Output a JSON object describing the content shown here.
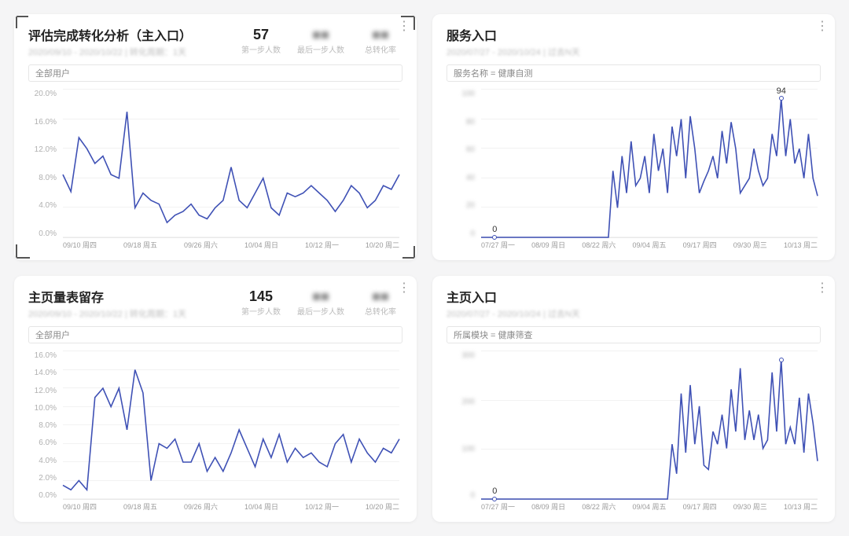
{
  "cards": [
    {
      "id": "card1",
      "title": "评估完成转化分析（主入口）",
      "subtitle": "2020/09/10 - 2020/10/22 | 转化周期：1天",
      "tag": "全部用户",
      "metrics": [
        {
          "value": "57",
          "label": "第一步人数",
          "blur": false
        },
        {
          "value": "■■",
          "label": "最后一步人数",
          "blur": true
        },
        {
          "value": "■■",
          "label": "总转化率",
          "blur": true
        }
      ],
      "selected": true
    },
    {
      "id": "card2",
      "title": "服务入口",
      "subtitle": "2020/07/27 - 2020/10/24 | 过去N天",
      "tag": "服务名称 = 健康自测",
      "annotation": {
        "value": "0"
      },
      "peak_annotation": {
        "value": "94"
      }
    },
    {
      "id": "card3",
      "title": "主页量表留存",
      "subtitle": "2020/09/10 - 2020/10/22 | 转化周期：1天",
      "tag": "全部用户",
      "metrics": [
        {
          "value": "145",
          "label": "第一步人数",
          "blur": false
        },
        {
          "value": "■■",
          "label": "最后一步人数",
          "blur": true
        },
        {
          "value": "■■",
          "label": "总转化率",
          "blur": true
        }
      ]
    },
    {
      "id": "card4",
      "title": "主页入口",
      "subtitle": "2020/07/27 - 2020/10/24 | 过去N天",
      "tag": "所属模块 = 健康筛查",
      "annotation": {
        "value": "0"
      }
    }
  ],
  "chart_data": [
    {
      "id": "card1",
      "type": "line",
      "title": "评估完成转化分析（主入口）",
      "ylabel": "",
      "xlabel": "",
      "ylim": [
        0,
        20
      ],
      "y_format": "percent",
      "x_ticks": [
        "09/10 周四",
        "09/18 周五",
        "09/26 周六",
        "10/04 周日",
        "10/12 周一",
        "10/20 周二"
      ],
      "y_ticks": [
        0,
        4,
        8,
        12,
        16,
        20
      ],
      "series": [
        {
          "name": "转化率",
          "values": [
            8.5,
            6.2,
            13.5,
            12.0,
            10.0,
            11.0,
            8.5,
            8.0,
            17.0,
            4.0,
            6.0,
            5.0,
            4.5,
            2.0,
            3.0,
            3.5,
            4.5,
            3.0,
            2.5,
            4.0,
            5.0,
            9.5,
            5.0,
            4.0,
            6.0,
            8.0,
            4.0,
            3.0,
            6.0,
            5.5,
            6.0,
            7.0,
            6.0,
            5.0,
            3.5,
            5.0,
            7.0,
            6.0,
            4.0,
            5.0,
            7.0,
            6.5,
            8.5
          ]
        }
      ]
    },
    {
      "id": "card2",
      "type": "line",
      "title": "服务入口",
      "ylabel": "",
      "xlabel": "",
      "ylim": [
        0,
        100
      ],
      "x_ticks": [
        "07/27 周一",
        "08/09 周日",
        "08/22 周六",
        "09/04 周五",
        "09/17 周四",
        "09/30 周三",
        "10/13 周二"
      ],
      "y_ticks": [
        0,
        20,
        40,
        60,
        80,
        100
      ],
      "annotation": {
        "index": 3,
        "value": 0
      },
      "series": [
        {
          "name": "count",
          "values": [
            0,
            0,
            0,
            0,
            0,
            0,
            0,
            0,
            0,
            0,
            0,
            0,
            0,
            0,
            0,
            0,
            0,
            0,
            0,
            0,
            0,
            0,
            0,
            0,
            0,
            0,
            0,
            0,
            0,
            45,
            20,
            55,
            30,
            65,
            35,
            40,
            55,
            30,
            70,
            45,
            60,
            30,
            75,
            55,
            80,
            40,
            82,
            60,
            30,
            38,
            45,
            55,
            40,
            72,
            50,
            78,
            60,
            30,
            35,
            40,
            60,
            45,
            35,
            40,
            70,
            55,
            94,
            55,
            80,
            50,
            60,
            40,
            70,
            40,
            28
          ]
        }
      ]
    },
    {
      "id": "card3",
      "type": "line",
      "title": "主页量表留存",
      "ylabel": "",
      "xlabel": "",
      "ylim": [
        0,
        16
      ],
      "y_format": "percent",
      "x_ticks": [
        "09/10 周四",
        "09/18 周五",
        "09/26 周六",
        "10/04 周日",
        "10/12 周一",
        "10/20 周二"
      ],
      "y_ticks": [
        0,
        2,
        4,
        6,
        8,
        10,
        12,
        14,
        16
      ],
      "series": [
        {
          "name": "留存率",
          "values": [
            1.5,
            1.0,
            2.0,
            1.0,
            11.0,
            12.0,
            10.0,
            12.0,
            7.5,
            14.0,
            11.5,
            2.0,
            6.0,
            5.5,
            6.5,
            4.0,
            4.0,
            6.0,
            3.0,
            4.5,
            3.0,
            5.0,
            7.5,
            5.5,
            3.5,
            6.5,
            4.5,
            7.0,
            4.0,
            5.5,
            4.5,
            5.0,
            4.0,
            3.5,
            6.0,
            7.0,
            4.0,
            6.5,
            5.0,
            4.0,
            5.5,
            5.0,
            6.5
          ]
        }
      ]
    },
    {
      "id": "card4",
      "type": "line",
      "title": "主页入口",
      "ylabel": "",
      "xlabel": "",
      "ylim": [
        0,
        350
      ],
      "x_ticks": [
        "07/27 周一",
        "08/09 周日",
        "08/22 周六",
        "09/04 周五",
        "09/17 周四",
        "09/30 周三",
        "10/13 周二"
      ],
      "y_ticks": [
        0,
        100,
        200,
        300
      ],
      "annotation": {
        "index": 3,
        "value": 0
      },
      "series": [
        {
          "name": "count",
          "values": [
            0,
            0,
            0,
            0,
            0,
            0,
            0,
            0,
            0,
            0,
            0,
            0,
            0,
            0,
            0,
            0,
            0,
            0,
            0,
            0,
            0,
            0,
            0,
            0,
            0,
            0,
            0,
            0,
            0,
            0,
            0,
            0,
            0,
            0,
            0,
            0,
            0,
            0,
            0,
            0,
            0,
            0,
            130,
            60,
            250,
            110,
            270,
            130,
            220,
            80,
            70,
            160,
            130,
            200,
            120,
            260,
            160,
            310,
            140,
            210,
            140,
            200,
            120,
            140,
            300,
            160,
            330,
            130,
            170,
            130,
            240,
            110,
            250,
            180,
            90
          ]
        }
      ]
    }
  ]
}
